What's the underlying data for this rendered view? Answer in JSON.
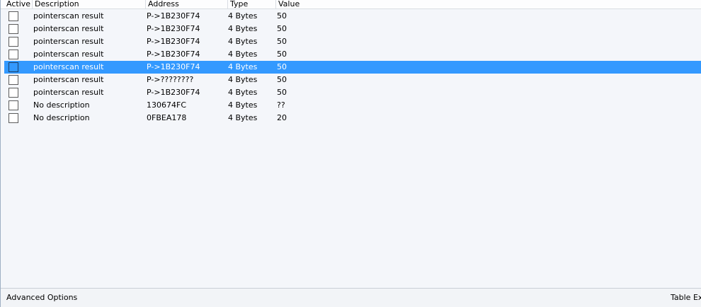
{
  "columns": {
    "active": "Active",
    "description": "Description",
    "address": "Address",
    "type": "Type",
    "value": "Value"
  },
  "rows": [
    {
      "active": false,
      "description": "pointerscan result",
      "address": "P->1B230F74",
      "type": "4 Bytes",
      "value": "50",
      "selected": false
    },
    {
      "active": false,
      "description": "pointerscan result",
      "address": "P->1B230F74",
      "type": "4 Bytes",
      "value": "50",
      "selected": false
    },
    {
      "active": false,
      "description": "pointerscan result",
      "address": "P->1B230F74",
      "type": "4 Bytes",
      "value": "50",
      "selected": false
    },
    {
      "active": false,
      "description": "pointerscan result",
      "address": "P->1B230F74",
      "type": "4 Bytes",
      "value": "50",
      "selected": false
    },
    {
      "active": false,
      "description": "pointerscan result",
      "address": "P->1B230F74",
      "type": "4 Bytes",
      "value": "50",
      "selected": true
    },
    {
      "active": false,
      "description": "pointerscan result",
      "address": "P->????????",
      "type": "4 Bytes",
      "value": "50",
      "selected": false
    },
    {
      "active": false,
      "description": "pointerscan result",
      "address": "P->1B230F74",
      "type": "4 Bytes",
      "value": "50",
      "selected": false
    },
    {
      "active": false,
      "description": "No description",
      "address": "130674FC",
      "type": "4 Bytes",
      "value": "??",
      "selected": false
    },
    {
      "active": false,
      "description": "No description",
      "address": "0FBEA178",
      "type": "4 Bytes",
      "value": "20",
      "selected": false
    }
  ],
  "footer": {
    "advanced_options": "Advanced Options",
    "table_extras": "Table Ex"
  },
  "colors": {
    "selection": "#3399ff",
    "background": "#f4f6fa"
  }
}
